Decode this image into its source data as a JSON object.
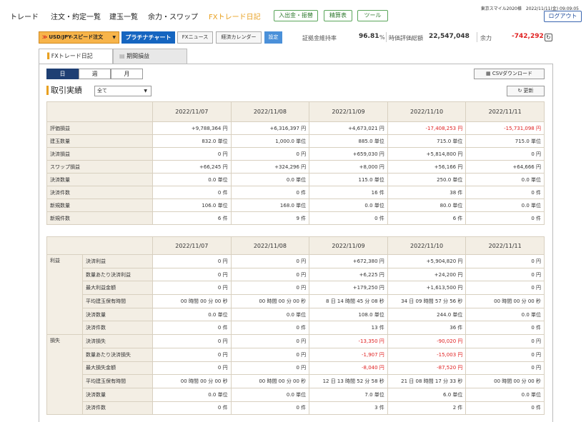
{
  "nav": {
    "items": [
      "トレード",
      "注文・約定一覧",
      "建玉一覧",
      "余力・スワップ",
      "FXトレード日記"
    ],
    "buttons": [
      "入出金・振替",
      "精算表",
      "ツール"
    ],
    "clock": "東京スマイル2020様　2022/11/11(金) 09:09:05",
    "logout": "ログアウト"
  },
  "toolbar": {
    "symbol": "USD/JPY-スピード注文",
    "platinum": "プラチナチャート",
    "fx_news": "FXニュース",
    "calendar": "経済カレンダー",
    "settings": "設定",
    "margin_label": "証拠金維持率",
    "margin_value": "96.81",
    "margin_unit": "%",
    "valuation_label": "時価評価総額",
    "valuation_value": "22,547,048",
    "surplus_label": "余力",
    "surplus_value": "-742,292"
  },
  "tabs": [
    "FXトレード日記",
    "期間損益"
  ],
  "period": [
    "日",
    "週",
    "月"
  ],
  "csv": "CSVダウンロード",
  "section_title": "取引実績",
  "filter": "全て",
  "refresh": "更新",
  "dates": [
    "2022/11/07",
    "2022/11/08",
    "2022/11/09",
    "2022/11/10",
    "2022/11/11"
  ],
  "table1": [
    {
      "label": "評価損益",
      "values": [
        "+9,788,364 円",
        "+6,316,397 円",
        "+4,673,021 円",
        "-17,408,253 円",
        "-15,731,098 円"
      ]
    },
    {
      "label": "建玉数量",
      "values": [
        "832.0 単位",
        "1,000.0 単位",
        "885.0 単位",
        "715.0 単位",
        "715.0 単位"
      ]
    },
    {
      "label": "決済損益",
      "values": [
        "0 円",
        "0 円",
        "+659,030 円",
        "+5,814,800 円",
        "0 円"
      ]
    },
    {
      "label": "スワップ損益",
      "values": [
        "+66,245 円",
        "+324,296 円",
        "+8,000 円",
        "+56,166 円",
        "+64,666 円"
      ]
    },
    {
      "label": "決済数量",
      "values": [
        "0.0 単位",
        "0.0 単位",
        "115.0 単位",
        "250.0 単位",
        "0.0 単位"
      ]
    },
    {
      "label": "決済件数",
      "values": [
        "0 件",
        "0 件",
        "16 件",
        "38 件",
        "0 件"
      ]
    },
    {
      "label": "新規数量",
      "values": [
        "106.0 単位",
        "168.0 単位",
        "0.0 単位",
        "80.0 単位",
        "0.0 単位"
      ]
    },
    {
      "label": "新規件数",
      "values": [
        "6 件",
        "9 件",
        "0 件",
        "6 件",
        "0 件"
      ]
    }
  ],
  "table2": [
    {
      "group": "利益",
      "label": "決済利益",
      "values": [
        "0 円",
        "0 円",
        "+672,380 円",
        "+5,904,820 円",
        "0 円"
      ]
    },
    {
      "group": "",
      "label": "数量あたり決済利益",
      "values": [
        "0 円",
        "0 円",
        "+6,225 円",
        "+24,200 円",
        "0 円"
      ]
    },
    {
      "group": "",
      "label": "最大利益金額",
      "values": [
        "0 円",
        "0 円",
        "+179,250 円",
        "+1,613,500 円",
        "0 円"
      ]
    },
    {
      "group": "",
      "label": "平均建玉保有時間",
      "values": [
        "00 時間 00 分 00 秒",
        "00 時間 00 分 00 秒",
        "8 日 14 時間 45 分 08 秒",
        "34 日 09 時間 57 分 56 秒",
        "00 時間 00 分 00 秒"
      ]
    },
    {
      "group": "",
      "label": "決済数量",
      "values": [
        "0.0 単位",
        "0.0 単位",
        "108.0 単位",
        "244.0 単位",
        "0.0 単位"
      ]
    },
    {
      "group": "",
      "label": "決済件数",
      "values": [
        "0 件",
        "0 件",
        "13 件",
        "36 件",
        "0 件"
      ]
    },
    {
      "group": "損失",
      "label": "決済損失",
      "values": [
        "0 円",
        "0 円",
        "-13,350 円",
        "-90,020 円",
        "0 円"
      ]
    },
    {
      "group": "",
      "label": "数量あたり決済損失",
      "values": [
        "0 円",
        "0 円",
        "-1,907 円",
        "-15,003 円",
        "0 円"
      ]
    },
    {
      "group": "",
      "label": "最大損失金額",
      "values": [
        "0 円",
        "0 円",
        "-8,040 円",
        "-87,520 円",
        "0 円"
      ]
    },
    {
      "group": "",
      "label": "平均建玉保有時間",
      "values": [
        "00 時間 00 分 00 秒",
        "00 時間 00 分 00 秒",
        "12 日 13 時間 52 分 58 秒",
        "21 日 08 時間 17 分 33 秒",
        "00 時間 00 分 00 秒"
      ]
    },
    {
      "group": "",
      "label": "決済数量",
      "values": [
        "0.0 単位",
        "0.0 単位",
        "7.0 単位",
        "6.0 単位",
        "0.0 単位"
      ]
    },
    {
      "group": "",
      "label": "決済件数",
      "values": [
        "0 件",
        "0 件",
        "3 件",
        "2 件",
        "0 件"
      ]
    }
  ],
  "colors": {
    "accent": "#e8a020",
    "negative": "#e02020",
    "platinum": "#1565c0",
    "active_tab": "#1e3f73"
  }
}
